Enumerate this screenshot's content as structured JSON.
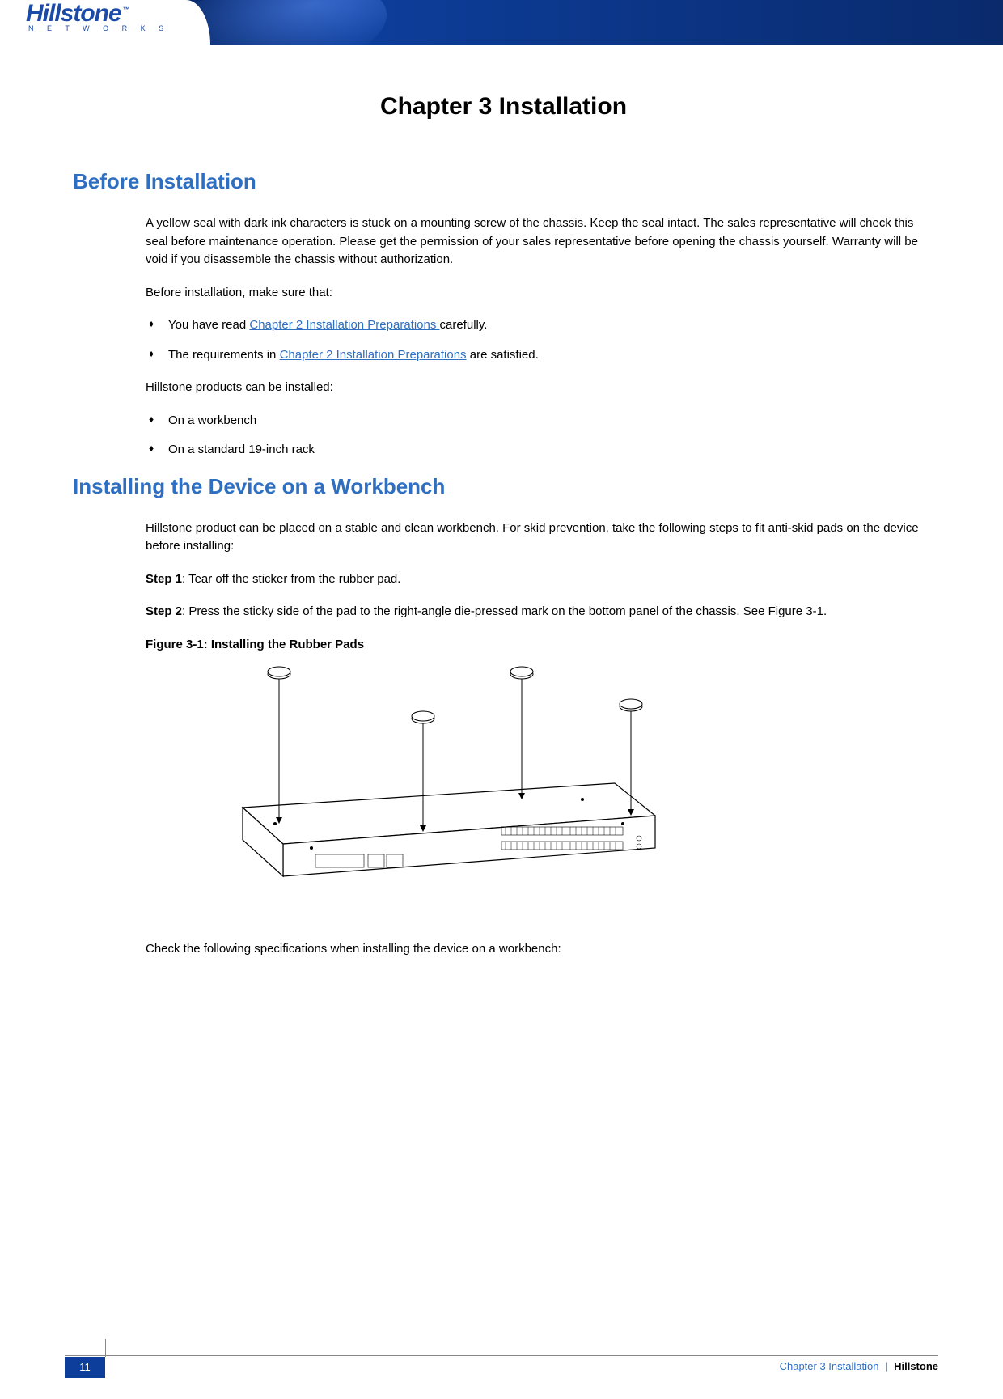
{
  "logo": {
    "main": "Hillstone",
    "tm": "™",
    "sub": "N E T W O R K S"
  },
  "title": "Chapter 3 Installation",
  "sections": {
    "before": {
      "heading": "Before Installation",
      "para1": "A yellow seal with dark ink characters is stuck on a mounting screw of the chassis. Keep the seal intact. The sales representative will check this seal before maintenance operation. Please get the permission of your sales representative before opening the chassis yourself. Warranty will be void if you disassemble the chassis without authorization.",
      "para2": "Before installation, make sure that:",
      "bullets1": {
        "b1_prefix": "You have read ",
        "b1_link": "Chapter 2 Installation Preparations ",
        "b1_suffix": "carefully.",
        "b2_prefix": "The requirements in ",
        "b2_link": "Chapter 2 Installation Preparations",
        "b2_suffix": " are satisfied."
      },
      "para3": "Hillstone products can be installed:",
      "bullets2": {
        "b1": "On a workbench",
        "b2": "On a standard 19-inch rack"
      }
    },
    "workbench": {
      "heading": "Installing the Device on a Workbench",
      "para1": "Hillstone product can be placed on a stable and clean workbench. For skid prevention, take the following steps to fit anti-skid pads on the device before installing:",
      "step1_label": "Step 1",
      "step1_text": ": Tear off the sticker from the rubber pad.",
      "step2_label": "Step 2",
      "step2_text": ": Press the sticky side of the pad to the right-angle die-pressed mark on the bottom panel of the chassis. See Figure 3-1.",
      "figcaption": "Figure 3-1: Installing the Rubber Pads",
      "para_after": "Check the following specifications when installing the device on a workbench:"
    }
  },
  "footer": {
    "page": "11",
    "chapter": "Chapter 3 Installation",
    "sep": "|",
    "brand": "Hillstone"
  }
}
